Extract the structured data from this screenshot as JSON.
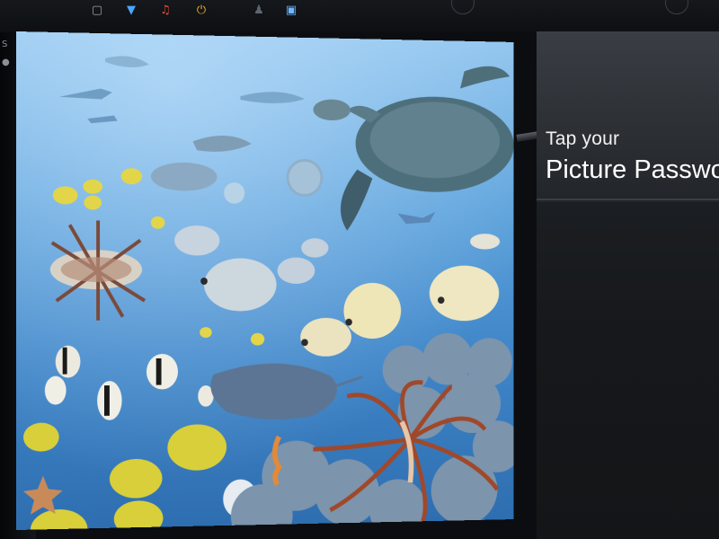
{
  "login": {
    "prompt_line1": "Tap your",
    "prompt_line2": "Picture Passwo"
  },
  "picture": {
    "subject": "underwater coral reef with tropical fish and sea turtle"
  },
  "tray": {
    "icons": [
      "window-icon",
      "wifi-icon",
      "accessibility-icon",
      "power-icon",
      "ease-of-access-icon",
      "lock-icon"
    ]
  },
  "bezel": {
    "glyph": "S"
  },
  "colors": {
    "panel": "#16181b",
    "water": "#5ea3dc",
    "text": "#ffffff"
  }
}
